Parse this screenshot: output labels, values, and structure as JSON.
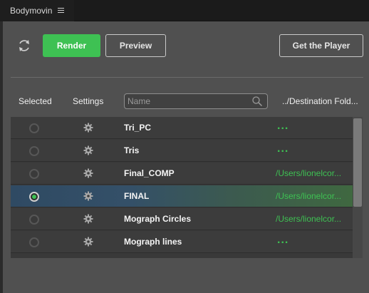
{
  "panel": {
    "title": "Bodymovin",
    "menu_icon": "hamburger-menu-icon"
  },
  "toolbar": {
    "sync_icon": "refresh-icon",
    "render_label": "Render",
    "preview_label": "Preview",
    "get_player_label": "Get the Player",
    "accent_color": "#3ec153"
  },
  "table": {
    "headers": {
      "selected": "Selected",
      "settings": "Settings",
      "destination": "../Destination Fold..."
    },
    "search": {
      "placeholder": "Name",
      "value": ""
    },
    "rows": [
      {
        "name": "Tri_PC",
        "destination": "...",
        "selected": false
      },
      {
        "name": "Tris",
        "destination": "...",
        "selected": false
      },
      {
        "name": "Final_COMP",
        "destination": "/Users/lionelcor...",
        "selected": false
      },
      {
        "name": "FINAL",
        "destination": "/Users/lionelcor...",
        "selected": true
      },
      {
        "name": "Mograph Circles",
        "destination": "/Users/lionelcor...",
        "selected": false
      },
      {
        "name": "Mograph lines",
        "destination": "...",
        "selected": false
      }
    ]
  }
}
